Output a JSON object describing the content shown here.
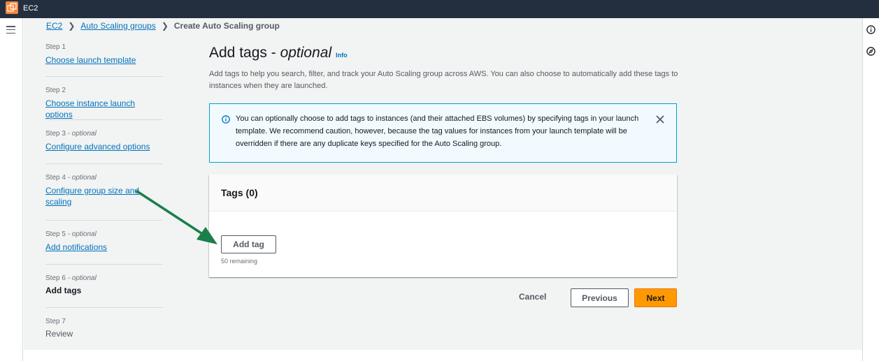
{
  "topbar": {
    "service_name": "EC2",
    "service_icon": "ec2-icon"
  },
  "breadcrumb": {
    "items": [
      "EC2",
      "Auto Scaling groups"
    ],
    "current": "Create Auto Scaling group"
  },
  "steps": [
    {
      "step": "Step 1",
      "optional": "",
      "label": "Choose launch template",
      "state": "link"
    },
    {
      "step": "Step 2",
      "optional": "",
      "label": "Choose instance launch options",
      "state": "link"
    },
    {
      "step": "Step 3",
      "optional": " - optional",
      "label": "Configure advanced options",
      "state": "link"
    },
    {
      "step": "Step 4",
      "optional": " - optional",
      "label": "Configure group size and scaling",
      "state": "link"
    },
    {
      "step": "Step 5",
      "optional": " - optional",
      "label": "Add notifications",
      "state": "link"
    },
    {
      "step": "Step 6",
      "optional": " - optional",
      "label": "Add tags",
      "state": "current"
    },
    {
      "step": "Step 7",
      "optional": "",
      "label": "Review",
      "state": "disabled"
    }
  ],
  "page": {
    "title": "Add tags - ",
    "title_italic": "optional",
    "info_link": "Info",
    "description": "Add tags to help you search, filter, and track your Auto Scaling group across AWS. You can also choose to automatically add these tags to instances when they are launched."
  },
  "alert": {
    "text": "You can optionally choose to add tags to instances (and their attached EBS volumes) by specifying tags in your launch template. We recommend caution, however, because the tag values for instances from your launch template will be overridden if there are any duplicate keys specified for the Auto Scaling group.",
    "icon": "info-circle-icon"
  },
  "tags_panel": {
    "title": "Tags (0)",
    "add_button": "Add tag",
    "remaining": "50 remaining"
  },
  "footer": {
    "cancel": "Cancel",
    "previous": "Previous",
    "next": "Next"
  },
  "colors": {
    "topbar": "#232f3e",
    "link": "#0073bb",
    "primary_button": "#ff9900",
    "alert_border": "#00a1c9",
    "annotation_arrow": "#1a7f4b"
  }
}
